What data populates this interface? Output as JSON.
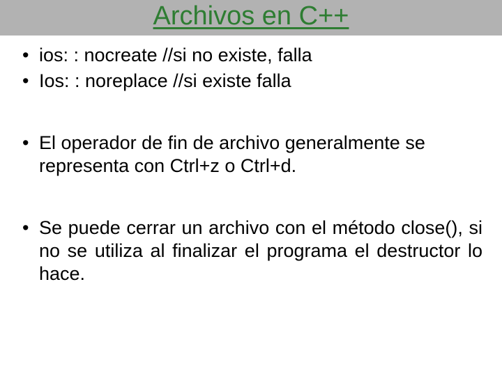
{
  "title": "Archivos en C++",
  "bullets": {
    "b1": "ios: : nocreate //si no existe, falla",
    "b2": "Ios: : noreplace //si existe falla",
    "b3": "El operador de fin de archivo generalmente se representa con Ctrl+z o Ctrl+d.",
    "b4": "Se puede cerrar un archivo con el método close(), si no se utiliza al finalizar el programa el destructor lo hace."
  }
}
